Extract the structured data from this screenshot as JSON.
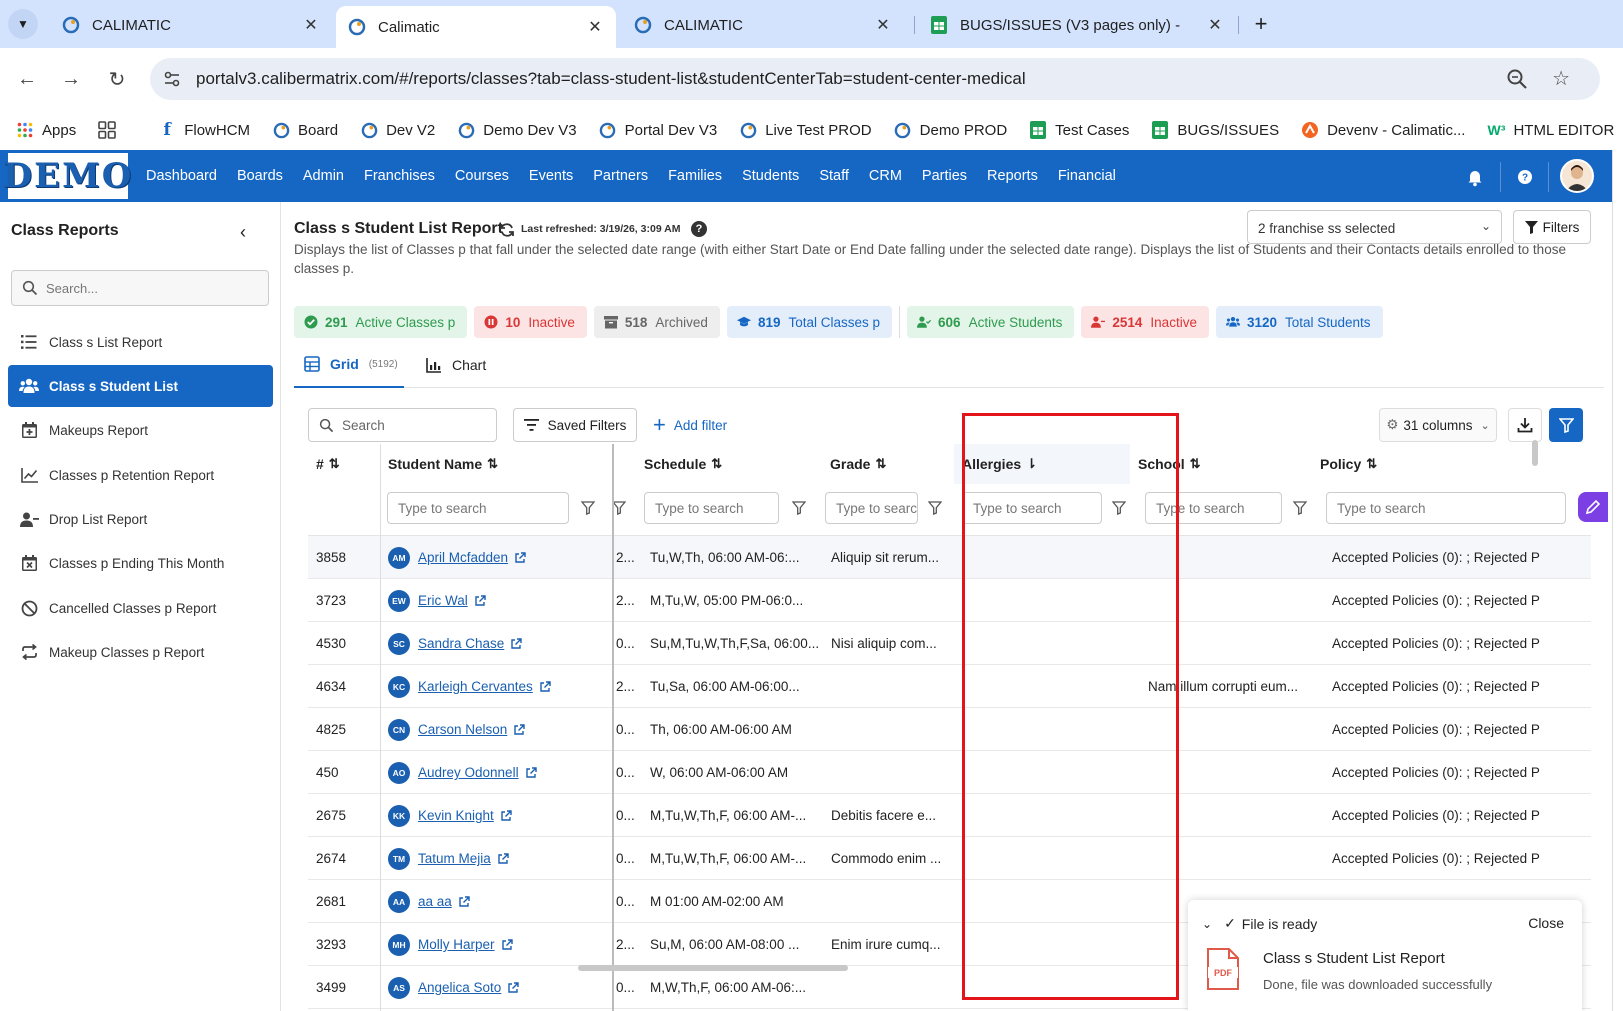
{
  "browser": {
    "tabs": [
      {
        "title": "CALIMATIC"
      },
      {
        "title": "Calimatic"
      },
      {
        "title": "CALIMATIC"
      },
      {
        "title": "BUGS/ISSUES (V3 pages only) -"
      }
    ],
    "url": "portalv3.calibermatrix.com/#/reports/classes?tab=class-student-list&studentCenterTab=student-center-medical",
    "bookmarks": [
      "Apps",
      "FlowHCM",
      "Board",
      "Dev V2",
      "Demo Dev V3",
      "Portal Dev V3",
      "Live Test PROD",
      "Demo PROD",
      "Test Cases",
      "BUGS/ISSUES",
      "Devenv - Calimatic...",
      "HTML EDITOR"
    ]
  },
  "app": {
    "logo": "DEMO",
    "nav": [
      "Dashboard",
      "Boards",
      "Admin",
      "Franchises",
      "Courses",
      "Events",
      "Partners",
      "Families",
      "Students",
      "Staff",
      "CRM",
      "Parties",
      "Reports",
      "Financial"
    ]
  },
  "sidebar": {
    "title": "Class Reports",
    "search_placeholder": "Search...",
    "items": [
      {
        "label": "Class s List Report"
      },
      {
        "label": "Class s Student List"
      },
      {
        "label": "Makeups Report"
      },
      {
        "label": "Classes p Retention Report"
      },
      {
        "label": "Drop List Report"
      },
      {
        "label": "Classes p Ending This Month"
      },
      {
        "label": "Cancelled Classes p Report"
      },
      {
        "label": "Makeup Classes p Report"
      }
    ]
  },
  "report": {
    "title": "Class s Student List Report",
    "last_refreshed": "Last refreshed: 3/19/26, 3:09 AM",
    "help": "?",
    "franchise_select": "2 franchise ss selected",
    "filters_label": "Filters",
    "description": "Displays the list of Classes p that fall under the selected date range (with either Start Date or End Date falling under the selected date range). Displays the list of Students and their Contacts details enrolled to those classes p.",
    "stats": [
      {
        "num": "291",
        "label": "Active Classes p",
        "color": "#2e9b4f",
        "bg": "#e3f5e8"
      },
      {
        "num": "10",
        "label": "Inactive",
        "color": "#d93636",
        "bg": "#fde4e4"
      },
      {
        "num": "518",
        "label": "Archived",
        "color": "#666666",
        "bg": "#eeeeee"
      },
      {
        "num": "819",
        "label": "Total Classes p",
        "color": "#1667c3",
        "bg": "#e4eefb"
      },
      {
        "num": "606",
        "label": "Active Students",
        "color": "#2e9b4f",
        "bg": "#e3f5e8"
      },
      {
        "num": "2514",
        "label": "Inactive",
        "color": "#d93636",
        "bg": "#fde4e4"
      },
      {
        "num": "3120",
        "label": "Total Students",
        "color": "#1667c3",
        "bg": "#e4eefb"
      }
    ],
    "tabs": {
      "grid": "Grid",
      "grid_count": "(5192)",
      "chart": "Chart"
    },
    "grid_search_placeholder": "Search",
    "saved_filters": "Saved Filters",
    "add_filter": "Add filter",
    "columns_btn": "31 columns",
    "columns": [
      "#",
      "Student Name",
      "Schedule",
      "Grade",
      "Allergies",
      "School",
      "Policy"
    ],
    "filter_placeholder": "Type to search",
    "rows": [
      {
        "id": "3858",
        "initials": "AM",
        "name": "April Mcfadden",
        "clip": "2...",
        "schedule": "Tu,W,Th, 06:00 AM-06:...",
        "grade": "Aliquip sit rerum...",
        "allergies": "",
        "school": "",
        "policy": "Accepted Policies (0): ; Rejected P"
      },
      {
        "id": "3723",
        "initials": "EW",
        "name": "Eric Wal",
        "clip": "2...",
        "schedule": "M,Tu,W, 05:00 PM-06:0...",
        "grade": "",
        "allergies": "",
        "school": "",
        "policy": "Accepted Policies (0): ; Rejected P"
      },
      {
        "id": "4530",
        "initials": "SC",
        "name": "Sandra Chase",
        "clip": "0...",
        "schedule": "Su,M,Tu,W,Th,F,Sa, 06:00...",
        "grade": "Nisi aliquip com...",
        "allergies": "",
        "school": "",
        "policy": "Accepted Policies (0): ; Rejected P"
      },
      {
        "id": "4634",
        "initials": "KC",
        "name": "Karleigh Cervantes",
        "clip": "2...",
        "schedule": "Tu,Sa, 06:00 AM-06:00...",
        "grade": "",
        "allergies": "",
        "school": "Nam illum corrupti eum...",
        "policy": "Accepted Policies (0): ; Rejected P"
      },
      {
        "id": "4825",
        "initials": "CN",
        "name": "Carson Nelson",
        "clip": "0...",
        "schedule": "Th, 06:00 AM-06:00 AM",
        "grade": "",
        "allergies": "",
        "school": "",
        "policy": "Accepted Policies (0): ; Rejected P"
      },
      {
        "id": "450",
        "initials": "AO",
        "name": "Audrey Odonnell",
        "clip": "0...",
        "schedule": "W, 06:00 AM-06:00 AM",
        "grade": "",
        "allergies": "",
        "school": "",
        "policy": "Accepted Policies (0): ; Rejected P"
      },
      {
        "id": "2675",
        "initials": "KK",
        "name": "Kevin Knight",
        "clip": "0...",
        "schedule": "M,Tu,W,Th,F, 06:00 AM-...",
        "grade": "Debitis facere e...",
        "allergies": "",
        "school": "",
        "policy": "Accepted Policies (0): ; Rejected P"
      },
      {
        "id": "2674",
        "initials": "TM",
        "name": "Tatum Mejia",
        "clip": "0...",
        "schedule": "M,Tu,W,Th,F, 06:00 AM-...",
        "grade": "Commodo enim ...",
        "allergies": "",
        "school": "",
        "policy": "Accepted Policies (0): ; Rejected P"
      },
      {
        "id": "2681",
        "initials": "AA",
        "name": "aa aa",
        "clip": "0...",
        "schedule": "M 01:00 AM-02:00 AM",
        "grade": "",
        "allergies": "",
        "school": "",
        "policy": ""
      },
      {
        "id": "3293",
        "initials": "MH",
        "name": "Molly Harper",
        "clip": "2...",
        "schedule": "Su,M, 06:00 AM-08:00 ...",
        "grade": "Enim irure cumq...",
        "allergies": "",
        "school": "",
        "policy": ""
      },
      {
        "id": "3499",
        "initials": "AS",
        "name": "Angelica Soto",
        "clip": "0...",
        "schedule": "M,W,Th,F, 06:00 AM-06:...",
        "grade": "",
        "allergies": "",
        "school": "",
        "policy": ""
      }
    ]
  },
  "toast": {
    "status": "File is ready",
    "close": "Close",
    "title": "Class s Student List Report",
    "subtitle": "Done, file was downloaded successfully",
    "file_type": "PDF"
  },
  "colors": {
    "primary": "#1667c3",
    "highlight": "#e3141a"
  }
}
